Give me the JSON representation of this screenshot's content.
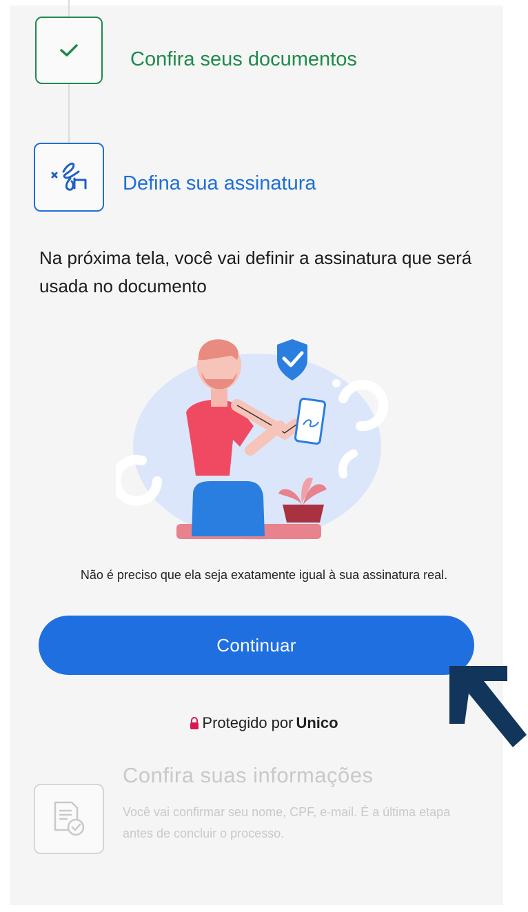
{
  "steps": [
    {
      "title": "Confira seus documentos",
      "icon": "check-icon",
      "state": "done",
      "color": "#1e8a4c"
    },
    {
      "title": "Defina sua assinatura",
      "icon": "signature-icon",
      "state": "active",
      "color": "#1f6fd6"
    },
    {
      "title": "Confira suas informações",
      "icon": "document-check-icon",
      "state": "pending",
      "color": "#c9c9c9",
      "description": "Você vai confirmar seu nome, CPF, e-mail. É a última etapa antes de concluir o processo."
    }
  ],
  "intro": "Na próxima tela, você vai definir a assinatura que será usada no documento",
  "note": "Não é preciso que ela seja exatamente igual à sua assinatura real.",
  "button": {
    "label": "Continuar",
    "color": "#1f6fe0"
  },
  "protected": {
    "prefix": "Protegido por",
    "brand": "Unico",
    "icon": "lock-icon"
  },
  "illustration": {
    "name": "person-signing-on-phone-illustration"
  },
  "overlay": {
    "icon": "arrow-pointer-icon",
    "color": "#12355b"
  }
}
